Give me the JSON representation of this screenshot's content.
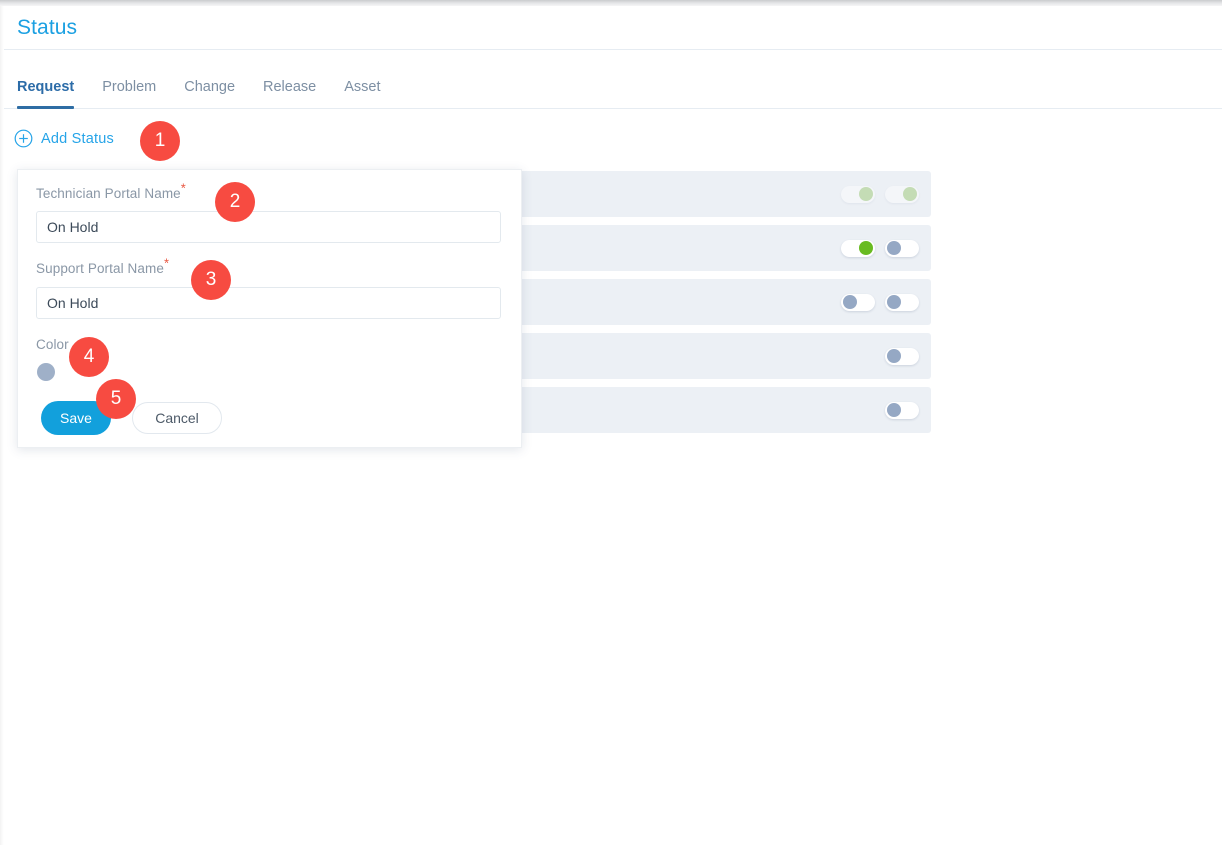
{
  "window": {
    "title": "Status"
  },
  "tabs": [
    {
      "label": "Request",
      "active": true
    },
    {
      "label": "Problem",
      "active": false
    },
    {
      "label": "Change",
      "active": false
    },
    {
      "label": "Release",
      "active": false
    },
    {
      "label": "Asset",
      "active": false
    }
  ],
  "toolbar": {
    "add_status_label": "Add Status",
    "add_status_icon": "circle-plus-icon"
  },
  "rows": [
    {
      "toggles": [
        {
          "state": "on",
          "faded": true
        },
        {
          "state": "on",
          "faded": true
        }
      ]
    },
    {
      "toggles": [
        {
          "state": "on",
          "faded": false
        },
        {
          "state": "off",
          "faded": false
        }
      ]
    },
    {
      "toggles": [
        {
          "state": "off",
          "faded": false
        },
        {
          "state": "off",
          "faded": false
        }
      ]
    },
    {
      "toggles": [
        {
          "state": "hidden",
          "faded": false
        },
        {
          "state": "off",
          "faded": false
        }
      ]
    },
    {
      "toggles": [
        {
          "state": "hidden",
          "faded": false
        },
        {
          "state": "off",
          "faded": false
        }
      ]
    }
  ],
  "panel": {
    "technician_portal_name": {
      "label": "Technician Portal Name",
      "required_marker": "*",
      "value": "On Hold",
      "placeholder": ""
    },
    "support_portal_name": {
      "label": "Support Portal Name",
      "required_marker": "*",
      "value": "On Hold",
      "placeholder": ""
    },
    "color": {
      "label": "Color",
      "swatch_hex": "#9fb0c8"
    },
    "save_label": "Save",
    "cancel_label": "Cancel"
  },
  "annotations": [
    {
      "number": "1"
    },
    {
      "number": "2"
    },
    {
      "number": "3"
    },
    {
      "number": "4"
    },
    {
      "number": "5"
    }
  ],
  "colors": {
    "title_blue": "#1ba0e2",
    "link_blue": "#26a4e8",
    "active_tab": "#2e6da4",
    "save_button": "#12a0dc",
    "badge_red": "#f74b41",
    "toggle_on_green": "#68bb21",
    "toggle_off_gray": "#95a8c4",
    "row_bg": "#ecf0f5",
    "required_star": "#e8553f"
  }
}
